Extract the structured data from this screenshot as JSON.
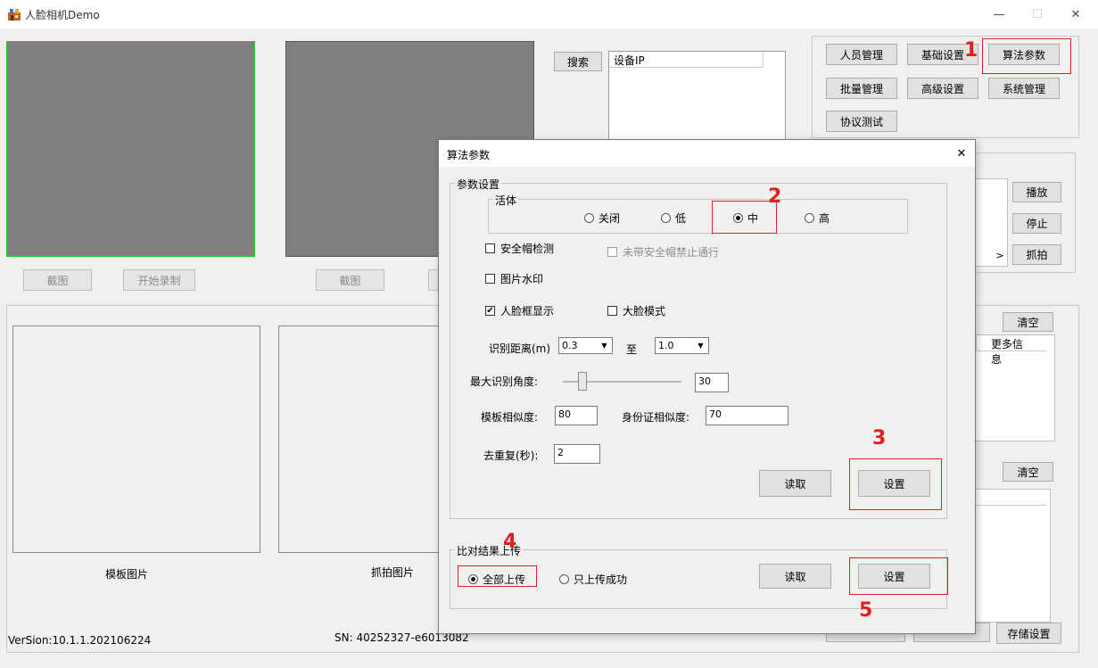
{
  "window": {
    "title": "人脸相机Demo",
    "controls": {
      "minimize": "—",
      "maximize": "☐",
      "close": "✕"
    }
  },
  "left": {
    "capture_btn_1": "截图",
    "record_btn": "开始录制",
    "capture_btn_2": "截图",
    "template_label": "模板图片",
    "snapshot_label": "抓拍图片",
    "version": "VerSion:10.1.1.202106224",
    "sn": "SN: 40252327-e6013082"
  },
  "device": {
    "search_btn": "搜索",
    "list_header": "设备IP"
  },
  "menu": {
    "person_mgmt": "人员管理",
    "basic_settings": "基础设置",
    "algo_params": "算法参数",
    "batch_mgmt": "批量管理",
    "advanced_settings": "高级设置",
    "system_mgmt": "系统管理",
    "protocol_test": "协议测试"
  },
  "right": {
    "play_btn": "播放",
    "stop_btn": "停止",
    "snap_btn": "抓拍",
    "clear_btn_1": "清空",
    "more_info": "更多信息",
    "clear_btn_2": "清空",
    "save_settings": "存储设置",
    "scroll_right": ">"
  },
  "dialog": {
    "title": "算法参数",
    "close": "✕",
    "params_group": "参数设置",
    "liveness_group": "活体",
    "liveness_options": [
      "关闭",
      "低",
      "中",
      "高"
    ],
    "liveness_selected": "中",
    "helmet_detect": "安全帽检测",
    "no_helmet_block": "未带安全帽禁止通行",
    "watermark": "图片水印",
    "face_box_display": "人脸框显示",
    "big_face_mode": "大脸模式",
    "face_box_checkmark": "✔",
    "distance_label": "识别距离(m)",
    "distance_from": "0.3",
    "distance_to_label": "至",
    "distance_to": "1.0",
    "combo_arrow": "▼",
    "max_angle_label": "最大识别角度:",
    "max_angle_value": "30",
    "max_angle": 30,
    "template_sim_label": "模板相似度:",
    "template_sim_value": "80",
    "id_sim_label": "身份证相似度:",
    "id_sim_value": "70",
    "dedup_label": "去重复(秒):",
    "dedup_value": "2",
    "read_btn": "读取",
    "set_btn": "设置",
    "upload_group": "比对结果上传",
    "upload_all": "全部上传",
    "upload_success_only": "只上传成功",
    "read_btn_2": "读取",
    "set_btn_2": "设置"
  },
  "annotations": [
    "1",
    "2",
    "3",
    "4",
    "5"
  ],
  "colors": {
    "annotation": "#e02020",
    "video_bg": "#808080",
    "active_border": "#22cc22"
  }
}
